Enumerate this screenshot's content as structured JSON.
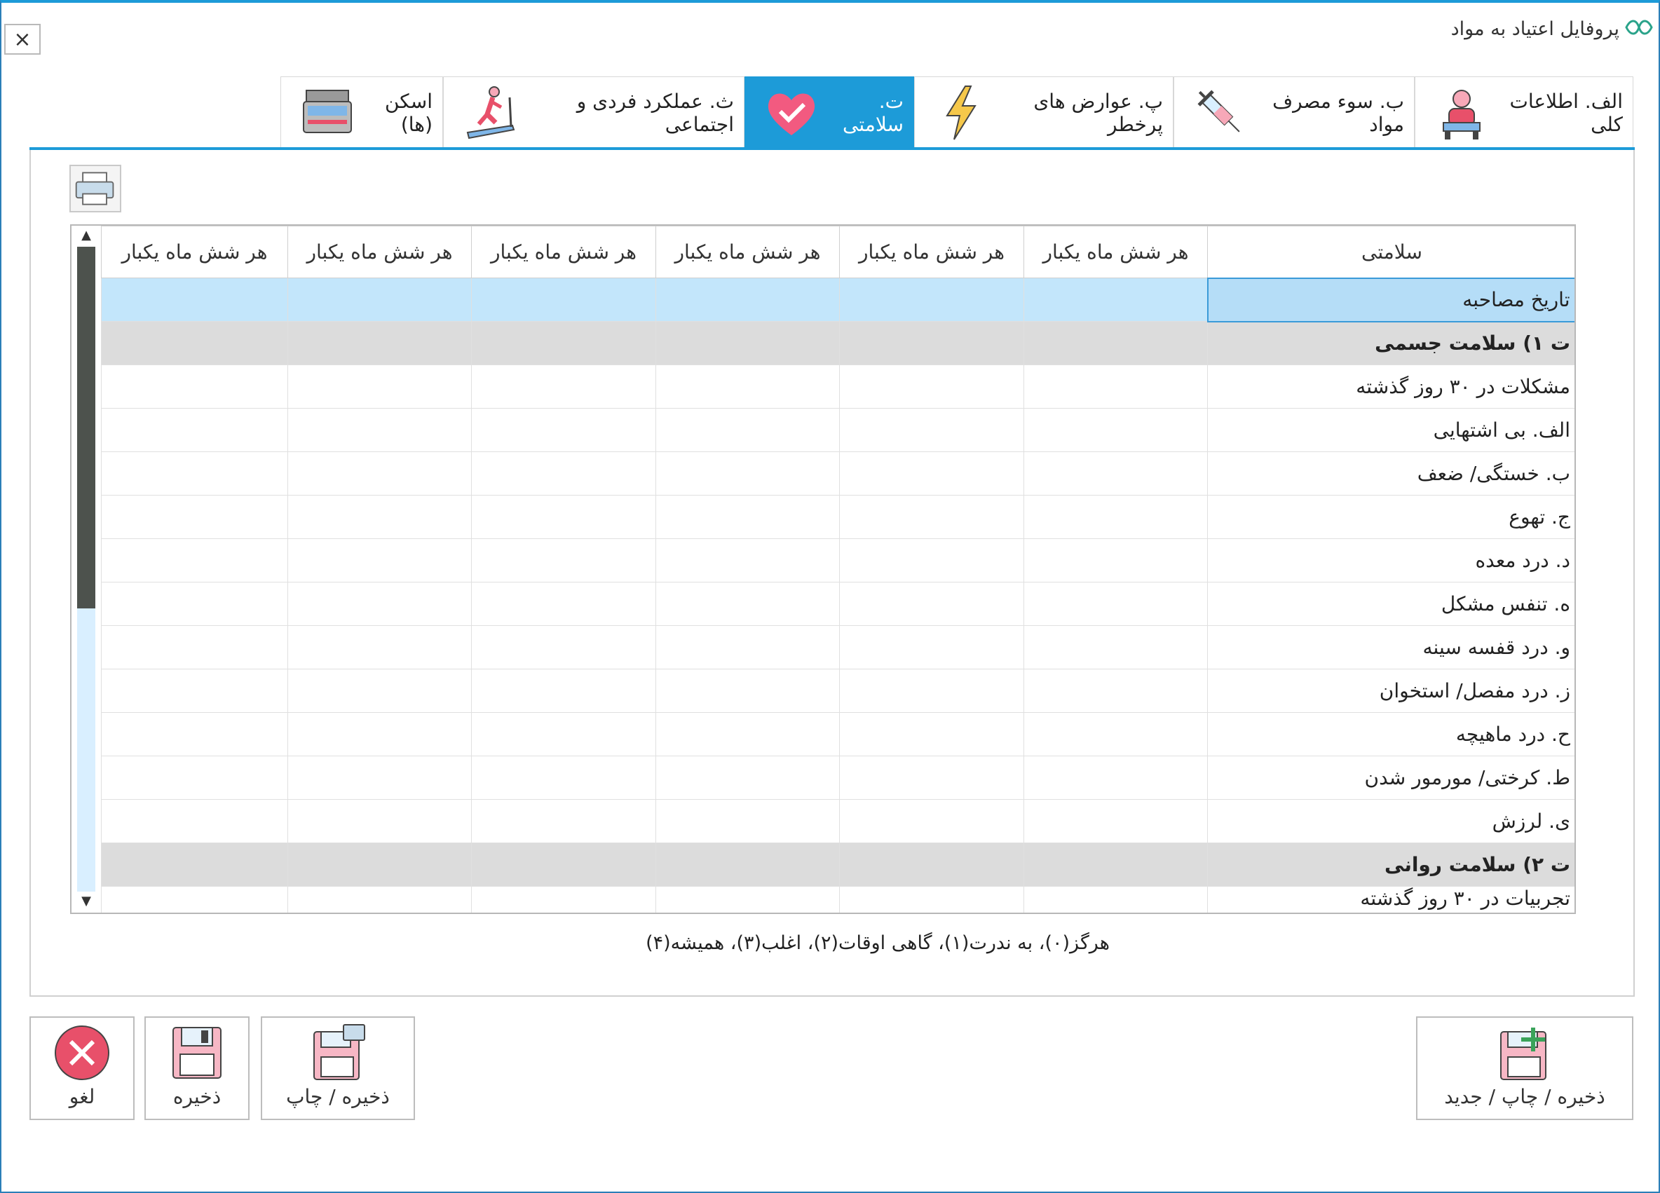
{
  "window": {
    "title": "پروفایل اعتیاد به مواد",
    "close_label": "×"
  },
  "tabs": [
    {
      "label": "الف. اطلاعات کلی",
      "icon": "people-sitting-icon"
    },
    {
      "label": "ب. سوء مصرف مواد",
      "icon": "syringe-icon"
    },
    {
      "label": "پ. عوارض های پرخطر",
      "icon": "lightning-icon"
    },
    {
      "label": "ت. سلامتی",
      "icon": "heart-check-icon"
    },
    {
      "label": "ث. عملکرد فردی و اجتماعی",
      "icon": "treadmill-runner-icon"
    },
    {
      "label": "اسکن (ها)",
      "icon": "scanner-icon"
    }
  ],
  "active_tab": 3,
  "grid": {
    "headers": [
      "سلامتی",
      "هر شش ماه یکبار",
      "هر شش ماه یکبار",
      "هر شش ماه یکبار",
      "هر شش ماه یکبار",
      "هر شش ماه یکبار",
      "هر شش ماه یکبار"
    ],
    "rows": [
      {
        "label": "تاریخ مصاحبه",
        "type": "selected"
      },
      {
        "label": "ت ۱) سلامت جسمی",
        "type": "section"
      },
      {
        "label": "مشکلات  در ۳۰ روز گذشته",
        "type": "normal"
      },
      {
        "label": "الف. بی اشتهایی",
        "type": "normal"
      },
      {
        "label": "ب. خستگی/ ضعف",
        "type": "normal"
      },
      {
        "label": "ج. تهوع",
        "type": "normal"
      },
      {
        "label": "د. درد معده",
        "type": "normal"
      },
      {
        "label": "ه. تنفس مشکل",
        "type": "normal"
      },
      {
        "label": "و. درد قفسه سینه",
        "type": "normal"
      },
      {
        "label": "ز. درد مفصل/ استخوان",
        "type": "normal"
      },
      {
        "label": "ح. درد ماهیچه",
        "type": "normal"
      },
      {
        "label": "ط. کرختی/ مورمور شدن",
        "type": "normal"
      },
      {
        "label": "ی. لرزش",
        "type": "normal"
      },
      {
        "label": "ت ۲) سلامت روانی",
        "type": "section"
      },
      {
        "label": "تجربیات در ۳۰ روز گذشته",
        "type": "partial"
      }
    ]
  },
  "legend": "هرگز(۰)، به ندرت(۱)، گاهی اوقات(۲)، اغلب(۳)، همیشه(۴)",
  "buttons": {
    "cancel": "لغو",
    "save": "ذخیره",
    "save_print": "ذخیره / چاپ",
    "save_print_new": "ذخیره / چاپ / جدید"
  },
  "colors": {
    "accent": "#1d9bd8",
    "selected_row": "#c3e6fb",
    "section_row": "#dcdcdc",
    "cancel_red": "#e8506a"
  }
}
